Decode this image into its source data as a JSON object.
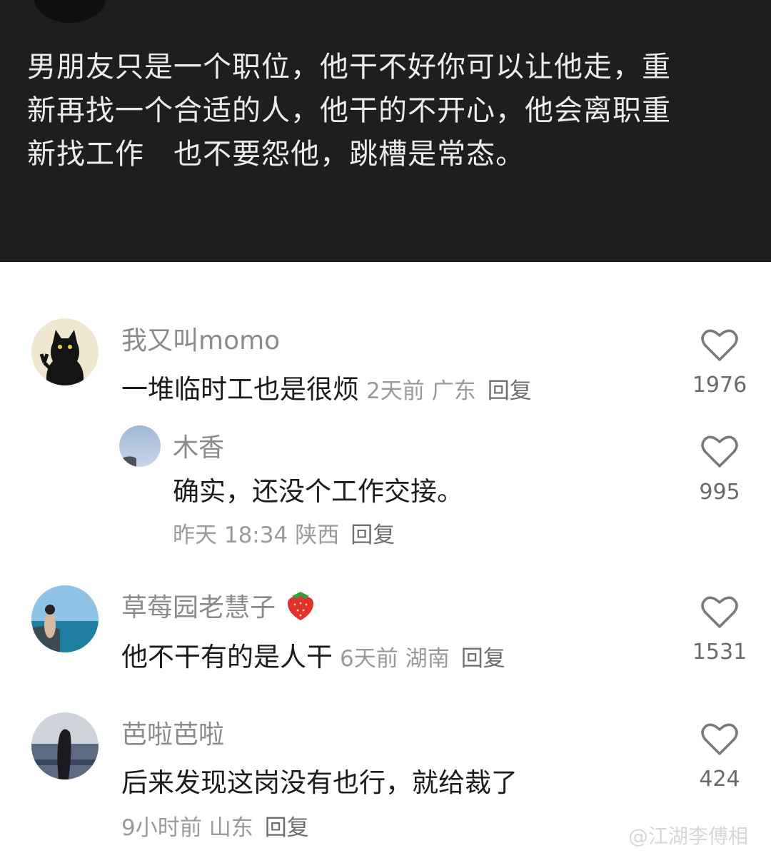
{
  "post": {
    "text": "男朋友只是一个职位，他干不好你可以让他走，重\n新再找一个合适的人，他干的不开心，他会离职重\n新找工作   也不要怨他，跳槽是常态。"
  },
  "comments": [
    {
      "username": "我又叫momo",
      "content": "一堆临时工也是很烦",
      "time": "2天前",
      "location": "广东",
      "reply_label": "回复",
      "likes": "1976"
    },
    {
      "username": "木香",
      "content": "确实，还没个工作交接。",
      "time": "昨天 18:34",
      "location": "陕西",
      "reply_label": "回复",
      "likes": "995"
    },
    {
      "username": "草莓园老慧子",
      "username_emoji": "strawberry",
      "content": "他不干有的是人干",
      "time": "6天前",
      "location": "湖南",
      "reply_label": "回复",
      "likes": "1531"
    },
    {
      "username": "芭啦芭啦",
      "content": "后来发现这岗没有也行，就给裁了",
      "time": "9小时前",
      "location": "山东",
      "reply_label": "回复",
      "likes": "424"
    }
  ],
  "watermark": "@江湖李傅相",
  "icons": {
    "like": "heart-outline-icon"
  },
  "colors": {
    "post_background": "#1e1e1e",
    "username": "#8b8b8b",
    "content": "#1c1c1c",
    "meta": "#9a9a9a"
  }
}
